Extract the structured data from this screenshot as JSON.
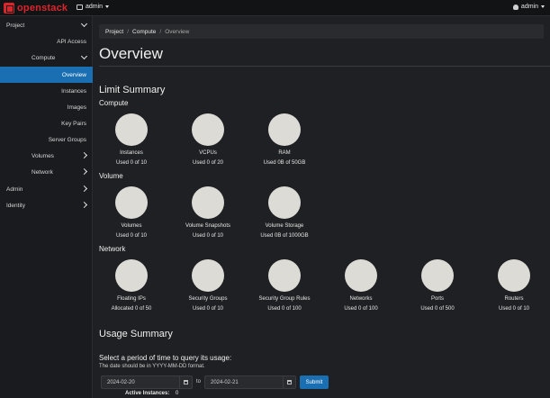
{
  "topbar": {
    "brand": "openstack",
    "project": "admin",
    "user": "admin"
  },
  "sidebar": {
    "project": "Project",
    "api_access": "API Access",
    "compute": "Compute",
    "overview": "Overview",
    "instances": "Instances",
    "images": "Images",
    "key_pairs": "Key Pairs",
    "server_groups": "Server Groups",
    "volumes": "Volumes",
    "network": "Network",
    "admin": "Admin",
    "identity": "Identity"
  },
  "breadcrumb": {
    "project": "Project",
    "compute": "Compute",
    "current": "Overview"
  },
  "page": {
    "title": "Overview",
    "limit_summary": "Limit Summary",
    "compute": "Compute",
    "volume": "Volume",
    "network": "Network",
    "usage_summary": "Usage Summary",
    "usage_desc": "Select a period of time to query its usage:",
    "usage_hint": "The date should be in YYYY-MM-DD format.",
    "start_date": "2024-02-20",
    "to": "to",
    "end_date": "2024-02-21",
    "submit": "Submit",
    "active_instances_label": "Active Instances:",
    "active_instances_value": "0"
  },
  "quotas": {
    "compute": [
      {
        "label": "Instances",
        "used": "Used 0 of 10"
      },
      {
        "label": "VCPUs",
        "used": "Used 0 of 20"
      },
      {
        "label": "RAM",
        "used": "Used 0B of 50GB"
      }
    ],
    "volume": [
      {
        "label": "Volumes",
        "used": "Used 0 of 10"
      },
      {
        "label": "Volume Snapshots",
        "used": "Used 0 of 10"
      },
      {
        "label": "Volume Storage",
        "used": "Used 0B of 1000GB"
      }
    ],
    "network": [
      {
        "label": "Floating IPs",
        "used": "Allocated 0 of 50"
      },
      {
        "label": "Security Groups",
        "used": "Used 0 of 10"
      },
      {
        "label": "Security Group Rules",
        "used": "Used 0 of 100"
      },
      {
        "label": "Networks",
        "used": "Used 0 of 100"
      },
      {
        "label": "Ports",
        "used": "Used 0 of 500"
      },
      {
        "label": "Routers",
        "used": "Used 0 of 10"
      }
    ]
  }
}
